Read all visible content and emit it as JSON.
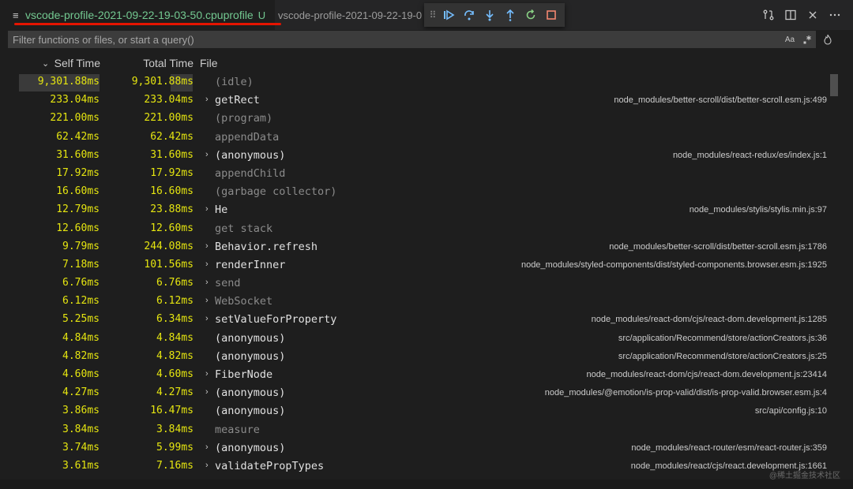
{
  "tabs": {
    "active": {
      "title": "vscode-profile-2021-09-22-19-03-50.cpuprofile",
      "status": "U"
    },
    "inactive": {
      "title": "vscode-profile-2021-09-22-19-0"
    }
  },
  "filter": {
    "placeholder": "Filter functions or files, or start a query()",
    "case_label": "Aa"
  },
  "columns": {
    "self": "Self Time",
    "total": "Total Time",
    "file": "File"
  },
  "rows": [
    {
      "self": "9,301.88ms",
      "total": "9,301.88ms",
      "fn": "(idle)",
      "path": "",
      "expandable": false,
      "dim": true
    },
    {
      "self": "233.04ms",
      "total": "233.04ms",
      "fn": "getRect",
      "path": "node_modules/better-scroll/dist/better-scroll.esm.js:499",
      "expandable": true,
      "dim": false
    },
    {
      "self": "221.00ms",
      "total": "221.00ms",
      "fn": "(program)",
      "path": "",
      "expandable": false,
      "dim": true
    },
    {
      "self": "62.42ms",
      "total": "62.42ms",
      "fn": "appendData",
      "path": "",
      "expandable": false,
      "dim": true
    },
    {
      "self": "31.60ms",
      "total": "31.60ms",
      "fn": "(anonymous)",
      "path": "node_modules/react-redux/es/index.js:1",
      "expandable": true,
      "dim": false
    },
    {
      "self": "17.92ms",
      "total": "17.92ms",
      "fn": "appendChild",
      "path": "",
      "expandable": false,
      "dim": true
    },
    {
      "self": "16.60ms",
      "total": "16.60ms",
      "fn": "(garbage collector)",
      "path": "",
      "expandable": false,
      "dim": true
    },
    {
      "self": "12.79ms",
      "total": "23.88ms",
      "fn": "He",
      "path": "node_modules/stylis/stylis.min.js:97",
      "expandable": true,
      "dim": false
    },
    {
      "self": "12.60ms",
      "total": "12.60ms",
      "fn": "get stack",
      "path": "",
      "expandable": false,
      "dim": true
    },
    {
      "self": "9.79ms",
      "total": "244.08ms",
      "fn": "Behavior.refresh",
      "path": "node_modules/better-scroll/dist/better-scroll.esm.js:1786",
      "expandable": true,
      "dim": false
    },
    {
      "self": "7.18ms",
      "total": "101.56ms",
      "fn": "renderInner",
      "path": "node_modules/styled-components/dist/styled-components.browser.esm.js:1925",
      "expandable": true,
      "dim": false
    },
    {
      "self": "6.76ms",
      "total": "6.76ms",
      "fn": "send",
      "path": "",
      "expandable": true,
      "dim": true
    },
    {
      "self": "6.12ms",
      "total": "6.12ms",
      "fn": "WebSocket",
      "path": "",
      "expandable": true,
      "dim": true
    },
    {
      "self": "5.25ms",
      "total": "6.34ms",
      "fn": "setValueForProperty",
      "path": "node_modules/react-dom/cjs/react-dom.development.js:1285",
      "expandable": true,
      "dim": false
    },
    {
      "self": "4.84ms",
      "total": "4.84ms",
      "fn": "(anonymous)",
      "path": "src/application/Recommend/store/actionCreators.js:36",
      "expandable": false,
      "dim": false
    },
    {
      "self": "4.82ms",
      "total": "4.82ms",
      "fn": "(anonymous)",
      "path": "src/application/Recommend/store/actionCreators.js:25",
      "expandable": false,
      "dim": false
    },
    {
      "self": "4.60ms",
      "total": "4.60ms",
      "fn": "FiberNode",
      "path": "node_modules/react-dom/cjs/react-dom.development.js:23414",
      "expandable": true,
      "dim": false
    },
    {
      "self": "4.27ms",
      "total": "4.27ms",
      "fn": "(anonymous)",
      "path": "node_modules/@emotion/is-prop-valid/dist/is-prop-valid.browser.esm.js:4",
      "expandable": true,
      "dim": false
    },
    {
      "self": "3.86ms",
      "total": "16.47ms",
      "fn": "(anonymous)",
      "path": "src/api/config.js:10",
      "expandable": false,
      "dim": false
    },
    {
      "self": "3.84ms",
      "total": "3.84ms",
      "fn": "measure",
      "path": "",
      "expandable": false,
      "dim": true
    },
    {
      "self": "3.74ms",
      "total": "5.99ms",
      "fn": "(anonymous)",
      "path": "node_modules/react-router/esm/react-router.js:359",
      "expandable": true,
      "dim": false
    },
    {
      "self": "3.61ms",
      "total": "7.16ms",
      "fn": "validatePropTypes",
      "path": "node_modules/react/cjs/react.development.js:1661",
      "expandable": true,
      "dim": false
    }
  ],
  "watermark": "@稀土掘金技术社区",
  "colors": {
    "accent_green": "#73c991",
    "time_yellow": "#e5e510",
    "underline_red": "#e51400",
    "debug_blue": "#75beff",
    "restart_green": "#89d185",
    "stop_red": "#f48771"
  }
}
